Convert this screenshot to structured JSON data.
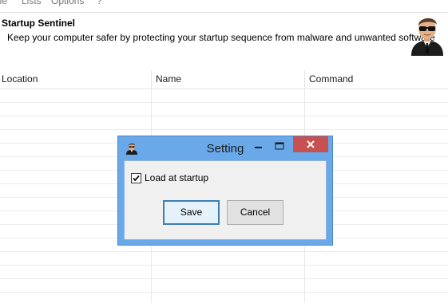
{
  "menu": {
    "file": "ile",
    "lists": "Lists",
    "options": "Options",
    "help": "?"
  },
  "banner": {
    "title": "Startup Sentinel",
    "subtitle": "Keep your computer safer by protecting your startup sequence from malware and unwanted software",
    "logo_icon": "agent-man-icon"
  },
  "list": {
    "columns": [
      "Location",
      "Name",
      "Command"
    ],
    "rows": []
  },
  "dialog": {
    "title": "Setting",
    "icon": "agent-man-icon",
    "checkbox_label": "Load at startup",
    "checkbox_checked": true,
    "save_label": "Save",
    "cancel_label": "Cancel"
  },
  "colors": {
    "dialog_frame": "#6aa9e9",
    "close_button": "#c75050",
    "default_button_border": "#3c7fb1"
  }
}
